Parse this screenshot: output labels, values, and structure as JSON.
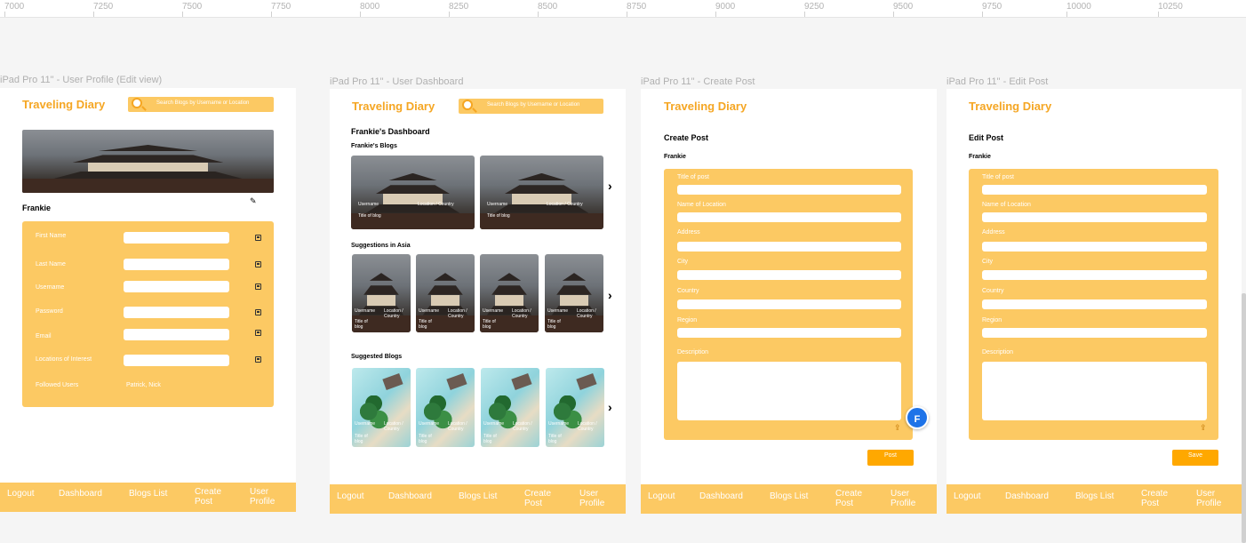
{
  "ruler": [
    "7000",
    "7250",
    "7500",
    "7750",
    "8000",
    "8250",
    "8500",
    "8750",
    "9000",
    "9250",
    "9500",
    "9750",
    "10000",
    "10250"
  ],
  "brand": "Traveling Diary",
  "search_placeholder": "Search Blogs by Username or Location",
  "nav": [
    "Logout",
    "Dashboard",
    "Blogs List",
    "Create Post",
    "User Profile"
  ],
  "colors": {
    "accent": "#fcc963",
    "brand": "#f5a623",
    "button": "#ffa800",
    "fab": "#1e73e8"
  },
  "frames": {
    "profile": {
      "label": "iPad Pro 11\" - User Profile (Edit view)",
      "username": "Frankie",
      "fields": [
        "First Name",
        "Last Name",
        "Username",
        "Password",
        "Email",
        "Locations of Interest"
      ],
      "followed_label": "Followed Users",
      "followed_value": "Patrick, Nick"
    },
    "dashboard": {
      "label": "iPad Pro 11\" - User Dashboard",
      "title": "Frankie's Dashboard",
      "sections": [
        "Frankie's Blogs",
        "Suggestions in Asia",
        "Suggested Blogs"
      ],
      "card_username": "Username",
      "card_location": "Location / Country",
      "card_title": "Title of blog"
    },
    "create": {
      "label": "iPad Pro 11\" - Create Post",
      "title": "Create Post",
      "username": "Frankie",
      "fields": [
        "Title of post",
        "Name of Location",
        "Address",
        "City",
        "Country",
        "Region",
        "Description"
      ],
      "button": "Post",
      "fab": "F"
    },
    "edit": {
      "label": "iPad Pro 11\" - Edit Post",
      "title": "Edit Post",
      "username": "Frankie",
      "fields": [
        "Title of post",
        "Name of Location",
        "Address",
        "City",
        "Country",
        "Region",
        "Description"
      ],
      "button": "Save"
    }
  }
}
